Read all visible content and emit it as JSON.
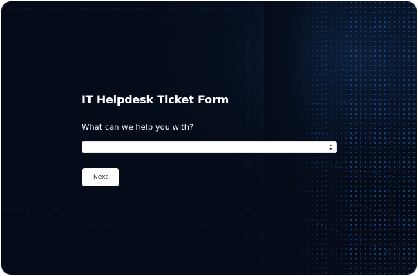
{
  "form": {
    "title": "IT Helpdesk Ticket Form",
    "question": "What can we help you with?",
    "select": {
      "selected_value": "",
      "options": []
    },
    "next_label": "Next"
  },
  "icons": {
    "select_arrow": "updown-chevron-icon"
  },
  "colors": {
    "background": "#050b18",
    "dot_accent": "#2f6fbf",
    "text": "#ffffff",
    "button_bg": "#ffffff"
  }
}
